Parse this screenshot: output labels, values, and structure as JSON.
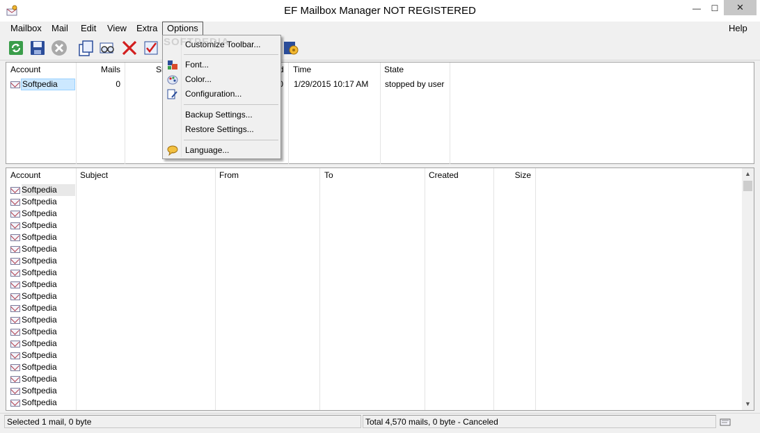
{
  "window": {
    "title": "EF Mailbox Manager NOT REGISTERED",
    "minimize": "—",
    "maximize": "☐",
    "close": "✕"
  },
  "menu": {
    "items": [
      "Mailbox",
      "Mail",
      "Edit",
      "View",
      "Extra",
      "Options"
    ],
    "help": "Help",
    "open": "Options"
  },
  "options_menu": {
    "items": [
      {
        "label": "Customize Toolbar...",
        "icon": "none"
      },
      {
        "label": "Font...",
        "icon": "font-icon"
      },
      {
        "label": "Color...",
        "icon": "color-palette-icon"
      },
      {
        "label": "Configuration...",
        "icon": "configuration-icon"
      },
      {
        "label": "Backup Settings...",
        "icon": "none"
      },
      {
        "label": "Restore Settings...",
        "icon": "none"
      },
      {
        "label": "Language...",
        "icon": "language-icon"
      }
    ]
  },
  "toolbar": {
    "buttons": [
      "refresh-icon",
      "save-icon",
      "stop-icon",
      "copy-icon",
      "find-icon",
      "delete-icon",
      "check-icon",
      "settings-icon"
    ]
  },
  "accounts_table": {
    "headers": [
      "Account",
      "Mails",
      "Si",
      "d",
      "Time",
      "State"
    ],
    "rows": [
      {
        "account": "Softpedia",
        "mails": "0",
        "d": "0",
        "time": "1/29/2015  10:17 AM",
        "state": "stopped by user"
      }
    ]
  },
  "mail_table": {
    "headers": [
      "Account",
      "Subject",
      "From",
      "To",
      "Created",
      "Size"
    ],
    "rows": [
      "Softpedia",
      "Softpedia",
      "Softpedia",
      "Softpedia",
      "Softpedia",
      "Softpedia",
      "Softpedia",
      "Softpedia",
      "Softpedia",
      "Softpedia",
      "Softpedia",
      "Softpedia",
      "Softpedia",
      "Softpedia",
      "Softpedia",
      "Softpedia",
      "Softpedia",
      "Softpedia",
      "Softpedia"
    ]
  },
  "scrollbar": {
    "up": "▲",
    "down": "▼"
  },
  "status": {
    "left": "Selected 1 mail, 0 byte",
    "right": "Total 4,570 mails, 0 byte - Canceled"
  },
  "watermark": "SOFTPEDIA",
  "colors": {
    "selection": "#cce8ff",
    "menu_bg": "#f0f0f0"
  }
}
